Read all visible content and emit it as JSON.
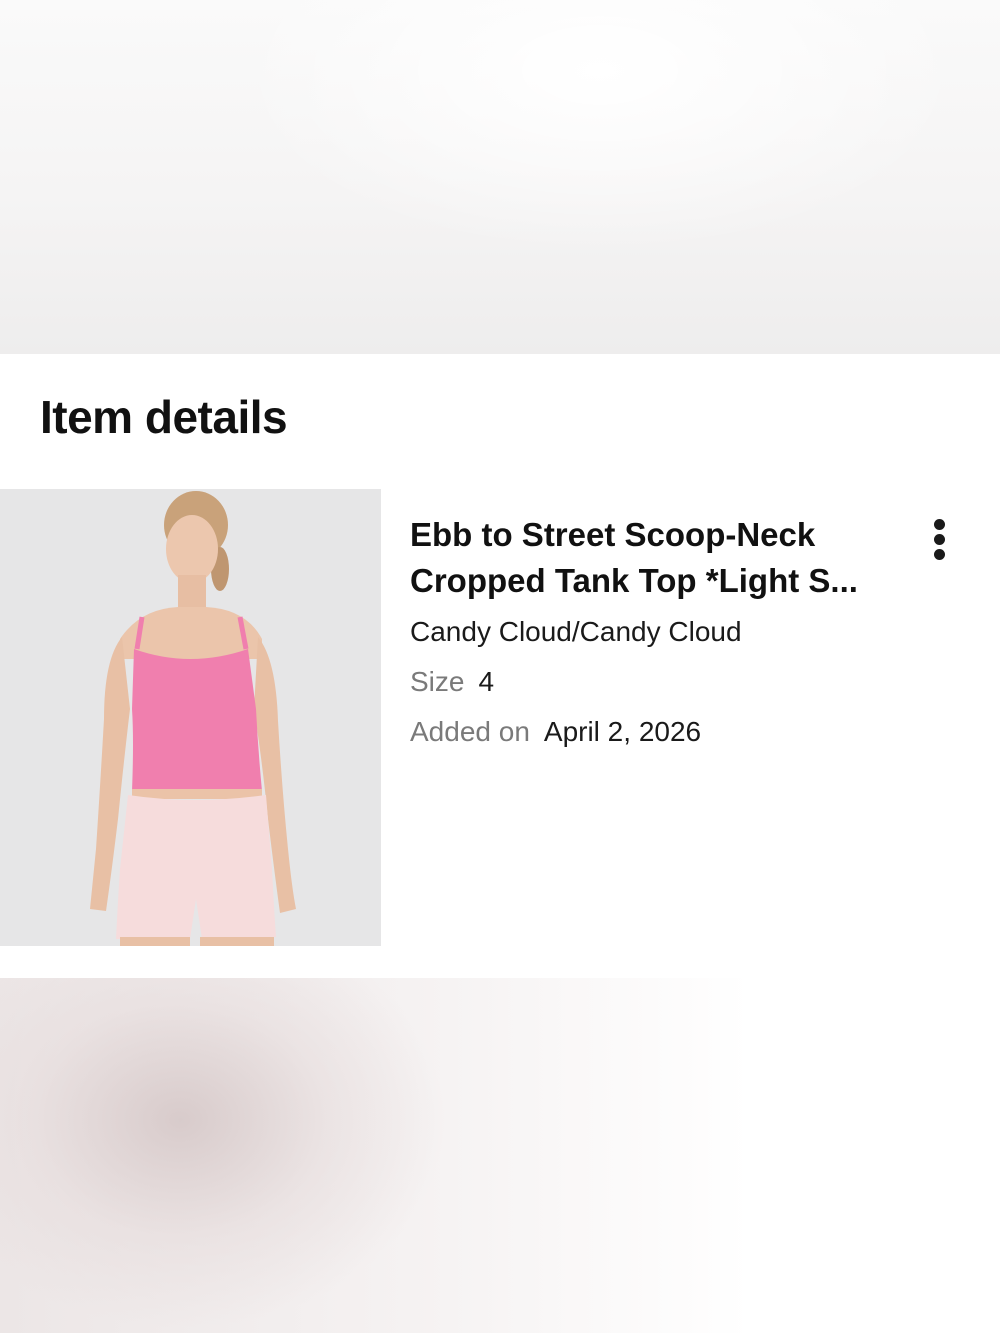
{
  "section": {
    "title": "Item details"
  },
  "item": {
    "name": "Ebb to Street Scoop-Neck Cropped Tank Top *Light S...",
    "color": "Candy Cloud/Candy Cloud",
    "size_label": "Size",
    "size_value": "4",
    "added_label": "Added on",
    "added_value": "April 2, 2026",
    "image_icon": "product-photo",
    "more_icon": "more-vertical-icon"
  },
  "colors": {
    "tank_pink": "#f07fae",
    "shorts_pink": "#f6dcdc",
    "skin": "#e9c3a9",
    "image_bg": "#e6e6e7",
    "muted_text": "#7a7a7a"
  }
}
